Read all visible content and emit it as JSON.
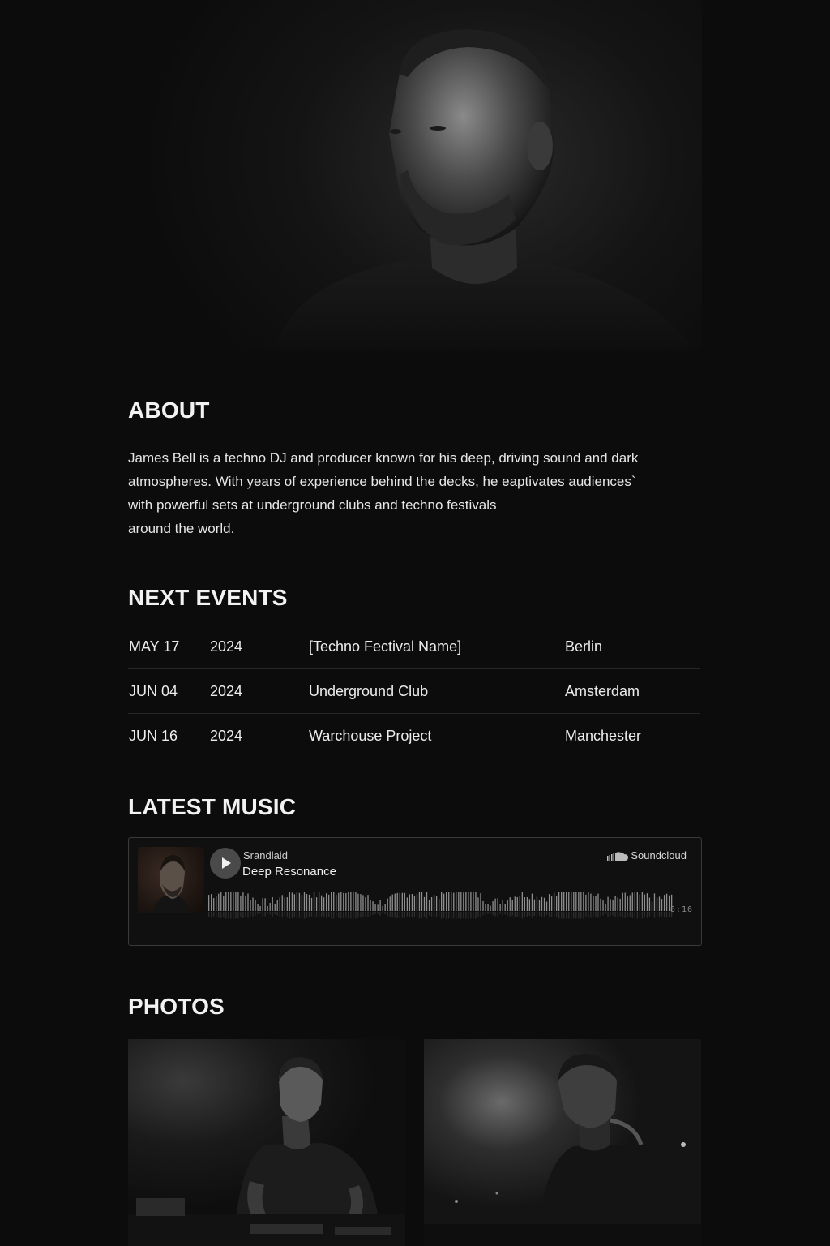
{
  "sections": {
    "about_title": "ABOUT",
    "events_title": "NEXT EVENTS",
    "music_title": "LATEST MUSIC",
    "photos_title": "PHOTOS"
  },
  "about": {
    "lines": [
      "James Bell is a techno DJ and producer known for his deep, driving sound and dark",
      "atmospheres. With years of experience behind the decks, he eaptivates audiences`",
      "with powerful sets at underground clubs and techno festivals",
      "around the world."
    ]
  },
  "events": [
    {
      "date": "MAY 17",
      "year": "2024",
      "name": "[Techno Fectival Name]",
      "city": "Berlin"
    },
    {
      "date": "JUN 04",
      "year": "2024",
      "name": "Underground Club",
      "city": "Amsterdam"
    },
    {
      "date": "JUN 16",
      "year": "2024",
      "name": "Warchouse Project",
      "city": "Manchester"
    }
  ],
  "player": {
    "artist": "Srandlaid",
    "track": "Deep Resonance",
    "platform": "Soundcloud",
    "duration": "8:16",
    "icons": {
      "play": "play-icon",
      "platform": "soundcloud-icon"
    }
  },
  "colors": {
    "background": "#0c0c0c",
    "text": "#e8e8e8",
    "divider": "#262626",
    "player_border": "#3a3a3a"
  }
}
